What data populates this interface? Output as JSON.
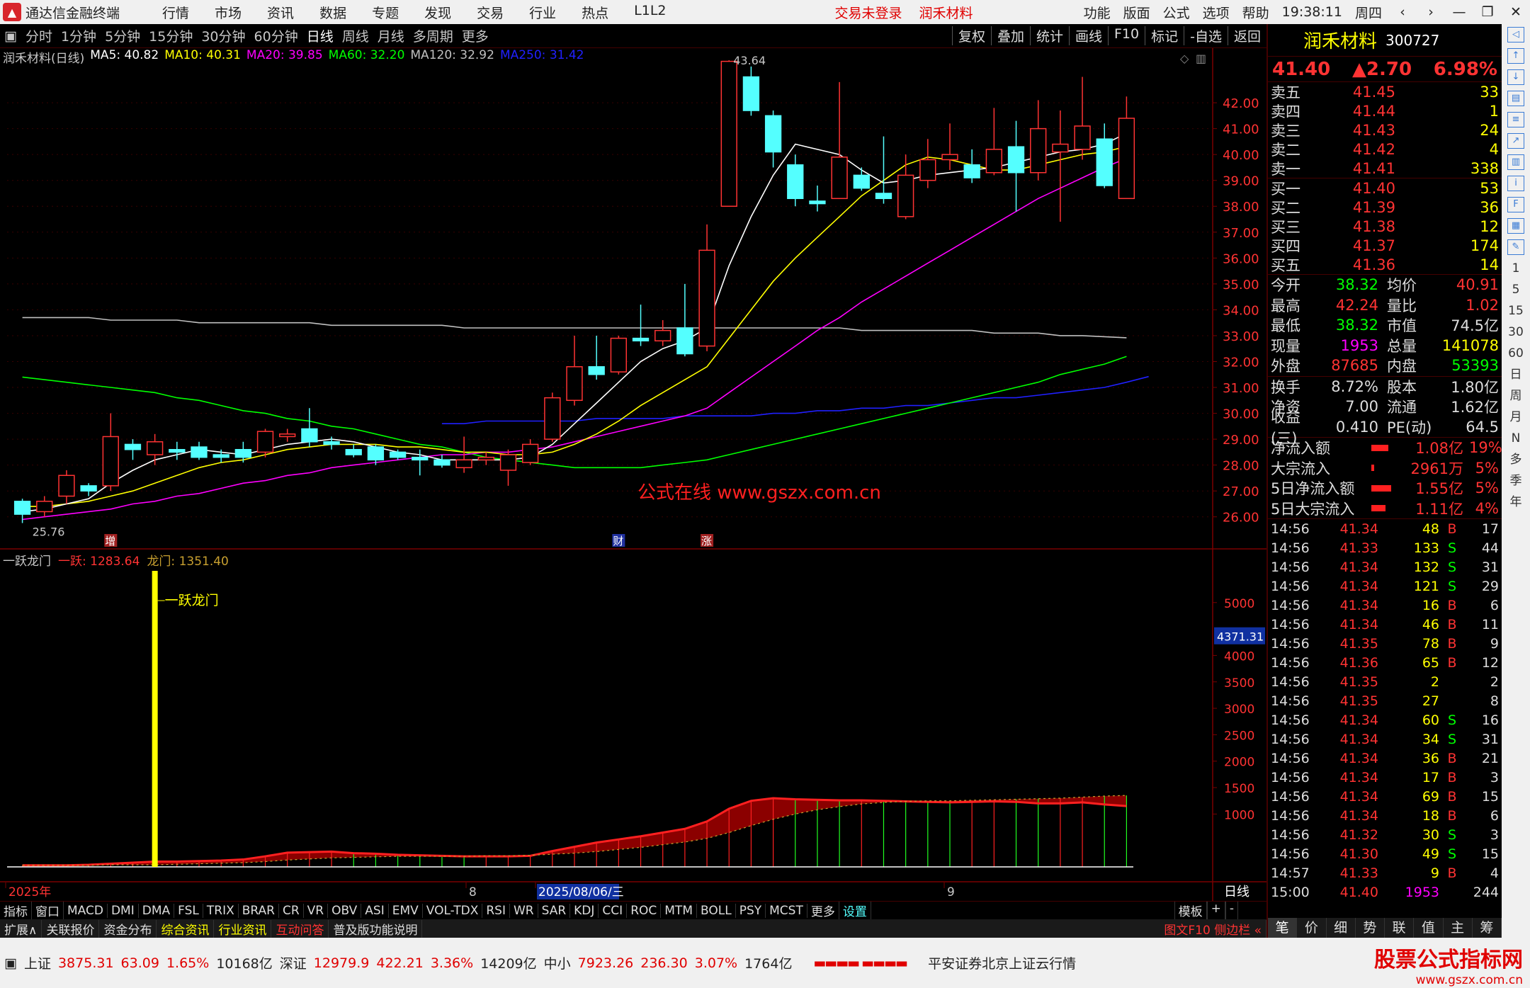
{
  "app": {
    "title": "通达信金融终端",
    "menu": [
      "行情",
      "市场",
      "资讯",
      "数据",
      "专题",
      "发现",
      "交易",
      "行业",
      "热点",
      "L1L2"
    ],
    "login_status": "交易未登录",
    "stock_tag": "润禾材料",
    "right_menu": [
      "功能",
      "版面",
      "公式",
      "选项",
      "帮助"
    ],
    "time": "19:38:11",
    "weekday": "周四"
  },
  "periods": {
    "items": [
      "分时",
      "1分钟",
      "5分钟",
      "15分钟",
      "30分钟",
      "60分钟",
      "日线",
      "周线",
      "月线",
      "多周期",
      "更多"
    ],
    "active": "日线",
    "tools": [
      "复权",
      "叠加",
      "统计",
      "画线",
      "F10",
      "标记",
      "-自选",
      "返回"
    ]
  },
  "main_legend": {
    "name": "润禾材料(日线)",
    "ma": [
      {
        "label": "MA5: 40.82",
        "color": "#ffffff"
      },
      {
        "label": "MA10: 40.31",
        "color": "#ffff00"
      },
      {
        "label": "MA20: 39.85",
        "color": "#ff00ff"
      },
      {
        "label": "MA60: 32.20",
        "color": "#00ff00"
      },
      {
        "label": "MA120: 32.92",
        "color": "#c0c0c0"
      },
      {
        "label": "MA250: 31.42",
        "color": "#2020ff"
      }
    ]
  },
  "price_axis": [
    "42.00",
    "41.00",
    "40.00",
    "39.00",
    "38.00",
    "37.00",
    "36.00",
    "35.00",
    "34.00",
    "33.00",
    "32.00",
    "31.00",
    "30.00",
    "29.00",
    "28.00",
    "27.00",
    "26.00"
  ],
  "annotations": {
    "high": "43.64",
    "low": "25.76",
    "watermark": "公式在线  www.gszx.com.cn",
    "markers": [
      "增",
      "财",
      "涨"
    ]
  },
  "indicator": {
    "name": "一跃龙门",
    "v1_label": "一跃: 1283.64",
    "v2_label": "龙门: 1351.40",
    "signal_label": "一跃龙门",
    "axis": [
      "5000",
      "4000",
      "3500",
      "3000",
      "2500",
      "2000",
      "1500",
      "1000"
    ],
    "cursor_value": "4371.31"
  },
  "date_axis": {
    "labels": [
      "2025年",
      "8",
      "2025/08/06/三",
      "9"
    ],
    "period": "日线"
  },
  "tabs": {
    "items": [
      "指标",
      "窗口",
      "MACD",
      "DMI",
      "DMA",
      "FSL",
      "TRIX",
      "BRAR",
      "CR",
      "VR",
      "OBV",
      "ASI",
      "EMV",
      "VOL-TDX",
      "RSI",
      "WR",
      "SAR",
      "KDJ",
      "CCI",
      "ROC",
      "MTM",
      "BOLL",
      "PSY",
      "MCST",
      "更多",
      "设置"
    ],
    "right": [
      "模板",
      "+",
      "-"
    ]
  },
  "ext": {
    "items": [
      "扩展∧",
      "关联报价",
      "资金分布",
      "综合资讯",
      "行业资讯",
      "互动问答",
      "普及版功能说明"
    ],
    "right": "图文F10 侧边栏 «"
  },
  "quote": {
    "name": "润禾材料",
    "code": "300727",
    "price": "41.40",
    "change": "▲2.70",
    "pct": "6.98%",
    "asks": [
      {
        "l": "卖五",
        "p": "41.45",
        "v": "33"
      },
      {
        "l": "卖四",
        "p": "41.44",
        "v": "1"
      },
      {
        "l": "卖三",
        "p": "41.43",
        "v": "24"
      },
      {
        "l": "卖二",
        "p": "41.42",
        "v": "4"
      },
      {
        "l": "卖一",
        "p": "41.41",
        "v": "338"
      }
    ],
    "bids": [
      {
        "l": "买一",
        "p": "41.40",
        "v": "53"
      },
      {
        "l": "买二",
        "p": "41.39",
        "v": "36"
      },
      {
        "l": "买三",
        "p": "41.38",
        "v": "12"
      },
      {
        "l": "买四",
        "p": "41.37",
        "v": "174"
      },
      {
        "l": "买五",
        "p": "41.36",
        "v": "14"
      }
    ],
    "stats": [
      {
        "k": "今开",
        "v": "38.32",
        "vc": "#00ff00",
        "k2": "均价",
        "v2": "40.91",
        "v2c": "#ff3333"
      },
      {
        "k": "最高",
        "v": "42.24",
        "vc": "#ff3333",
        "k2": "量比",
        "v2": "1.02",
        "v2c": "#ff3333"
      },
      {
        "k": "最低",
        "v": "38.32",
        "vc": "#00ff00",
        "k2": "市值",
        "v2": "74.5亿",
        "v2c": "#dddddd"
      },
      {
        "k": "现量",
        "v": "1953",
        "vc": "#ff00ff",
        "k2": "总量",
        "v2": "141078",
        "v2c": "#ffff00"
      },
      {
        "k": "外盘",
        "v": "87685",
        "vc": "#ff3333",
        "k2": "内盘",
        "v2": "53393",
        "v2c": "#00ff00"
      }
    ],
    "stats2": [
      {
        "k": "换手",
        "v": "8.72%",
        "vc": "#dddddd",
        "k2": "股本",
        "v2": "1.80亿",
        "v2c": "#dddddd"
      },
      {
        "k": "净资",
        "v": "7.00",
        "vc": "#dddddd",
        "k2": "流通",
        "v2": "1.62亿",
        "v2c": "#dddddd"
      },
      {
        "k": "收益(三)",
        "v": "0.410",
        "vc": "#dddddd",
        "k2": "PE(动)",
        "v2": "64.5",
        "v2c": "#dddddd"
      }
    ],
    "flows": [
      {
        "k": "净流入额",
        "v": "1.08亿",
        "p": "19%",
        "w": "24"
      },
      {
        "k": "大宗流入",
        "v": "2961万",
        "p": "5%",
        "w": "4"
      },
      {
        "k": "5日净流入额",
        "v": "1.55亿",
        "p": "5%",
        "w": "28"
      },
      {
        "k": "5日大宗流入",
        "v": "1.11亿",
        "p": "4%",
        "w": "20"
      }
    ],
    "ticks": [
      {
        "t": "14:56",
        "p": "41.34",
        "v": "48",
        "s": "B",
        "c": "17"
      },
      {
        "t": "14:56",
        "p": "41.33",
        "v": "133",
        "s": "S",
        "c": "44"
      },
      {
        "t": "14:56",
        "p": "41.34",
        "v": "132",
        "s": "S",
        "c": "31"
      },
      {
        "t": "14:56",
        "p": "41.34",
        "v": "121",
        "s": "S",
        "c": "29"
      },
      {
        "t": "14:56",
        "p": "41.34",
        "v": "16",
        "s": "B",
        "c": "6"
      },
      {
        "t": "14:56",
        "p": "41.34",
        "v": "46",
        "s": "B",
        "c": "11"
      },
      {
        "t": "14:56",
        "p": "41.35",
        "v": "78",
        "s": "B",
        "c": "9"
      },
      {
        "t": "14:56",
        "p": "41.36",
        "v": "65",
        "s": "B",
        "c": "12"
      },
      {
        "t": "14:56",
        "p": "41.35",
        "v": "2",
        "s": "",
        "c": "2"
      },
      {
        "t": "14:56",
        "p": "41.35",
        "v": "27",
        "s": "",
        "c": "8"
      },
      {
        "t": "14:56",
        "p": "41.34",
        "v": "60",
        "s": "S",
        "c": "16"
      },
      {
        "t": "14:56",
        "p": "41.34",
        "v": "34",
        "s": "S",
        "c": "31"
      },
      {
        "t": "14:56",
        "p": "41.34",
        "v": "36",
        "s": "B",
        "c": "21"
      },
      {
        "t": "14:56",
        "p": "41.34",
        "v": "17",
        "s": "B",
        "c": "3"
      },
      {
        "t": "14:56",
        "p": "41.34",
        "v": "69",
        "s": "B",
        "c": "15"
      },
      {
        "t": "14:56",
        "p": "41.34",
        "v": "18",
        "s": "B",
        "c": "6"
      },
      {
        "t": "14:56",
        "p": "41.32",
        "v": "30",
        "s": "S",
        "c": "3"
      },
      {
        "t": "14:56",
        "p": "41.30",
        "v": "49",
        "s": "S",
        "c": "15"
      },
      {
        "t": "14:57",
        "p": "41.33",
        "v": "9",
        "s": "B",
        "c": "4"
      },
      {
        "t": "15:00",
        "p": "41.40",
        "v": "1953",
        "s": "",
        "c": "244"
      }
    ],
    "tabs": [
      "笔",
      "价",
      "细",
      "势",
      "联",
      "值",
      "主",
      "筹"
    ]
  },
  "sidebar": {
    "items": [
      "1",
      "5",
      "15",
      "30",
      "60",
      "日",
      "周",
      "月",
      "N",
      "多",
      "季",
      "年"
    ]
  },
  "statusbar": {
    "sh": {
      "name": "上证",
      "v": "3875.31",
      "c": "63.09",
      "p": "1.65%",
      "amt": "10168亿"
    },
    "sz": {
      "name": "深证",
      "v": "12979.9",
      "c": "422.21",
      "p": "3.36%",
      "amt": "14209亿"
    },
    "zx": {
      "name": "中小",
      "v": "7923.26",
      "c": "236.30",
      "p": "3.07%",
      "amt": "1764亿"
    },
    "broker": "平安证券北京上证云行情",
    "brand1": "股票公式指标网",
    "brand2": "www.gszx.com.cn"
  },
  "colors": {
    "up": "#ff3333",
    "down": "#54ffff",
    "ma5": "#ffffff",
    "ma10": "#ffff00",
    "ma20": "#ff00ff",
    "ma60": "#00ff00",
    "ma120": "#c0c0c0",
    "ma250": "#2020ff"
  },
  "chart_data": {
    "type": "candlestick",
    "ylim": [
      25.5,
      44
    ],
    "candles": [
      [
        26.6,
        26.1,
        26.7,
        25.76
      ],
      [
        26.2,
        26.6,
        26.8,
        26.0
      ],
      [
        26.8,
        27.6,
        27.8,
        26.5
      ],
      [
        27.2,
        27.0,
        27.3,
        26.8
      ],
      [
        27.2,
        29.1,
        30.0,
        27.0
      ],
      [
        28.8,
        28.6,
        29.0,
        28.2
      ],
      [
        28.4,
        28.9,
        29.2,
        28.0
      ],
      [
        28.6,
        28.5,
        28.9,
        28.2
      ],
      [
        28.7,
        28.3,
        28.9,
        28.2
      ],
      [
        28.4,
        28.3,
        28.6,
        28.1
      ],
      [
        28.6,
        28.3,
        28.9,
        28.1
      ],
      [
        28.5,
        29.3,
        29.4,
        28.3
      ],
      [
        29.1,
        29.2,
        29.4,
        28.9
      ],
      [
        29.4,
        28.9,
        30.2,
        28.7
      ],
      [
        28.9,
        28.8,
        29.1,
        28.6
      ],
      [
        28.6,
        28.4,
        28.8,
        28.3
      ],
      [
        28.7,
        28.2,
        28.8,
        28.0
      ],
      [
        28.5,
        28.3,
        28.6,
        28.2
      ],
      [
        28.3,
        28.2,
        28.6,
        27.6
      ],
      [
        28.2,
        28.0,
        28.4,
        27.9
      ],
      [
        27.9,
        28.2,
        29.1,
        27.7
      ],
      [
        28.2,
        28.3,
        28.5,
        28.0
      ],
      [
        27.8,
        28.4,
        28.6,
        27.2
      ],
      [
        28.1,
        28.8,
        29.0,
        28.0
      ],
      [
        29.0,
        30.6,
        30.8,
        28.9
      ],
      [
        30.5,
        31.8,
        33.0,
        30.3
      ],
      [
        31.8,
        31.5,
        33.0,
        31.3
      ],
      [
        31.6,
        32.9,
        33.0,
        31.5
      ],
      [
        32.9,
        32.8,
        34.2,
        32.6
      ],
      [
        32.8,
        33.2,
        33.6,
        32.6
      ],
      [
        33.3,
        32.3,
        35.0,
        32.2
      ],
      [
        32.6,
        36.3,
        37.3,
        32.4
      ],
      [
        38.0,
        43.6,
        43.64,
        38.0
      ],
      [
        43.0,
        41.7,
        43.4,
        41.5
      ],
      [
        41.5,
        40.1,
        41.7,
        39.5
      ],
      [
        39.6,
        38.3,
        40.0,
        38.0
      ],
      [
        38.2,
        38.1,
        38.8,
        37.8
      ],
      [
        38.3,
        39.9,
        42.8,
        38.3
      ],
      [
        39.2,
        38.7,
        39.5,
        38.6
      ],
      [
        38.5,
        38.3,
        40.7,
        38.1
      ],
      [
        37.6,
        39.2,
        40.0,
        37.5
      ],
      [
        39.0,
        39.8,
        40.6,
        38.7
      ],
      [
        39.8,
        40.0,
        41.2,
        39.4
      ],
      [
        39.6,
        39.1,
        40.2,
        38.9
      ],
      [
        39.3,
        40.2,
        41.8,
        39.2
      ],
      [
        40.3,
        39.3,
        41.3,
        37.8
      ],
      [
        39.3,
        41.0,
        42.1,
        39.0
      ],
      [
        40.1,
        40.4,
        41.7,
        37.4
      ],
      [
        40.2,
        41.1,
        43.0,
        39.8
      ],
      [
        40.6,
        38.8,
        41.2,
        38.7
      ],
      [
        38.3,
        41.4,
        42.24,
        38.32
      ]
    ],
    "ma5": [
      26.2,
      26.3,
      26.5,
      26.7,
      27.3,
      27.8,
      28.2,
      28.4,
      28.6,
      28.5,
      28.4,
      28.6,
      28.8,
      28.9,
      29.0,
      28.9,
      28.7,
      28.5,
      28.4,
      28.2,
      28.2,
      28.2,
      28.2,
      28.3,
      28.8,
      29.6,
      30.4,
      31.2,
      32.0,
      32.5,
      32.8,
      33.3,
      35.7,
      37.6,
      39.2,
      40.4,
      40.2,
      40.0,
      39.4,
      38.9,
      39.0,
      39.2,
      39.3,
      39.4,
      39.5,
      39.7,
      39.9,
      40.1,
      40.2,
      40.4,
      40.82
    ],
    "ma10": [
      26.4,
      26.4,
      26.5,
      26.6,
      26.8,
      27.0,
      27.3,
      27.6,
      27.9,
      28.1,
      28.2,
      28.4,
      28.6,
      28.7,
      28.8,
      28.8,
      28.8,
      28.7,
      28.7,
      28.6,
      28.5,
      28.5,
      28.4,
      28.4,
      28.5,
      28.8,
      29.2,
      29.7,
      30.3,
      30.8,
      31.3,
      31.8,
      32.9,
      34.0,
      35.1,
      36.0,
      36.8,
      37.6,
      38.4,
      39.0,
      39.6,
      39.9,
      39.8,
      39.6,
      39.4,
      39.4,
      39.6,
      39.8,
      40.0,
      40.1,
      40.31
    ],
    "ma20": [
      25.9,
      26.0,
      26.1,
      26.2,
      26.3,
      26.5,
      26.6,
      26.8,
      26.9,
      27.1,
      27.3,
      27.4,
      27.6,
      27.7,
      27.9,
      28.0,
      28.1,
      28.2,
      28.3,
      28.4,
      28.4,
      28.5,
      28.5,
      28.6,
      28.7,
      28.9,
      29.1,
      29.3,
      29.5,
      29.7,
      29.9,
      30.2,
      30.8,
      31.4,
      32.0,
      32.6,
      33.2,
      33.7,
      34.3,
      34.8,
      35.3,
      35.8,
      36.3,
      36.8,
      37.3,
      37.8,
      38.3,
      38.7,
      39.1,
      39.5,
      39.85
    ],
    "ma60": [
      31.4,
      31.3,
      31.2,
      31.1,
      31.0,
      30.9,
      30.8,
      30.6,
      30.5,
      30.3,
      30.1,
      30.0,
      29.8,
      29.7,
      29.5,
      29.4,
      29.2,
      29.0,
      28.8,
      28.7,
      28.5,
      28.3,
      28.2,
      28.1,
      28.0,
      27.9,
      27.9,
      27.9,
      27.9,
      28.0,
      28.1,
      28.2,
      28.4,
      28.6,
      28.8,
      29.0,
      29.2,
      29.4,
      29.6,
      29.8,
      30.0,
      30.2,
      30.4,
      30.6,
      30.8,
      31.0,
      31.2,
      31.5,
      31.7,
      31.9,
      32.2
    ],
    "ma120": [
      33.7,
      33.7,
      33.7,
      33.7,
      33.6,
      33.6,
      33.6,
      33.6,
      33.5,
      33.5,
      33.5,
      33.5,
      33.5,
      33.5,
      33.4,
      33.4,
      33.4,
      33.4,
      33.4,
      33.4,
      33.3,
      33.3,
      33.3,
      33.3,
      33.3,
      33.3,
      33.3,
      33.3,
      33.3,
      33.3,
      33.3,
      33.3,
      33.3,
      33.3,
      33.3,
      33.3,
      33.3,
      33.3,
      33.2,
      33.2,
      33.2,
      33.2,
      33.2,
      33.2,
      33.1,
      33.1,
      33.1,
      33.0,
      33.0,
      32.96,
      32.92
    ],
    "ma250_start": 19,
    "ma250": [
      29.6,
      29.6,
      29.7,
      29.7,
      29.7,
      29.7,
      29.7,
      29.8,
      29.8,
      29.8,
      29.8,
      29.9,
      29.9,
      29.9,
      29.9,
      30.0,
      30.0,
      30.1,
      30.1,
      30.2,
      30.2,
      30.3,
      30.3,
      30.4,
      30.5,
      30.6,
      30.6,
      30.7,
      30.8,
      30.9,
      31.0,
      31.2,
      31.42
    ],
    "indicator_fast": [
      30,
      30,
      30,
      40,
      60,
      80,
      100,
      100,
      110,
      120,
      140,
      200,
      270,
      280,
      290,
      260,
      250,
      230,
      220,
      210,
      200,
      200,
      200,
      210,
      300,
      380,
      460,
      520,
      580,
      650,
      720,
      860,
      1100,
      1250,
      1300,
      1280,
      1270,
      1260,
      1260,
      1250,
      1240,
      1230,
      1220,
      1230,
      1240,
      1230,
      1200,
      1200,
      1220,
      1180,
      1150
    ],
    "indicator_slow": [
      30,
      30,
      30,
      30,
      40,
      40,
      40,
      50,
      60,
      70,
      80,
      100,
      130,
      150,
      170,
      180,
      190,
      200,
      200,
      200,
      200,
      210,
      210,
      220,
      240,
      260,
      290,
      330,
      370,
      420,
      470,
      540,
      650,
      780,
      900,
      1000,
      1080,
      1140,
      1190,
      1220,
      1240,
      1250,
      1250,
      1260,
      1270,
      1280,
      1290,
      1300,
      1320,
      1340,
      1351.4
    ],
    "indicator_signal_index": 6
  }
}
